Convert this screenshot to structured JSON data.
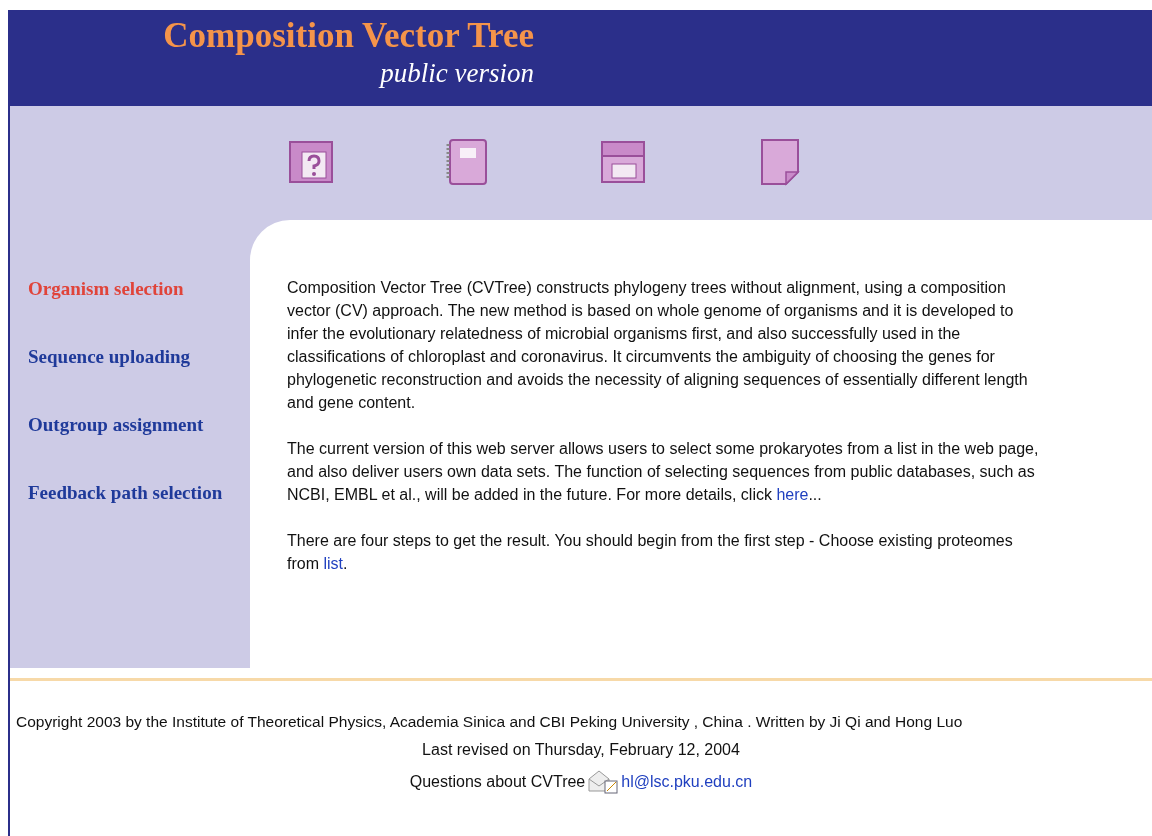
{
  "header": {
    "title": "Composition Vector Tree",
    "subtitle": "public version"
  },
  "toolbar": [
    {
      "kind": "help"
    },
    {
      "kind": "notebook"
    },
    {
      "kind": "folders"
    },
    {
      "kind": "page"
    }
  ],
  "sidebar": {
    "items": [
      {
        "label": "Organism selection",
        "selected": true
      },
      {
        "label": "Sequence uploading",
        "selected": false
      },
      {
        "label": "Outgroup assignment",
        "selected": false
      },
      {
        "label": "Feedback path selection",
        "selected": false
      }
    ]
  },
  "content": {
    "paragraphs": [
      {
        "text": "Composition Vector Tree (CVTree) constructs phylogeny trees without alignment, using a composition vector (CV) approach. The new method is based on whole genome of organisms and it is developed to infer the evolutionary relatedness of microbial organisms first, and also successfully used in the classifications of chloroplast and coronavirus. It circumvents the ambiguity of choosing the genes for phylogenetic reconstruction and avoids the necessity of aligning sequences of essentially different length and gene content."
      },
      {
        "text": "The current version of this web server allows users to select some prokaryotes from a list in the web page, and also deliver users own data sets. The function of selecting sequences from public databases, such as NCBI, EMBL et al., will be added in the future. For more details, click ",
        "link": "here",
        "after": "..."
      },
      {
        "text": "There are four steps to get the result. You should begin from the first step - Choose existing proteomes from ",
        "link": "list",
        "after": "."
      }
    ]
  },
  "footer": {
    "copyright": "Copyright 2003 by the Institute of Theoretical Physics, Academia Sinica and CBI Peking University , China . Written by Ji Qi and Hong Luo",
    "revised": "Last revised on Thursday, February 12, 2004",
    "questions": "Questions about CVTree",
    "email": "hl@lsc.pku.edu.cn"
  }
}
